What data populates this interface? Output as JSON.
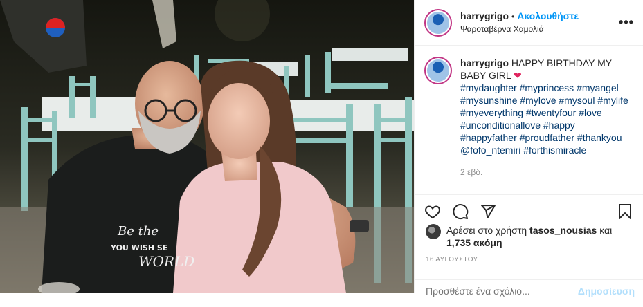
{
  "header": {
    "username": "harrygrigo",
    "separator": "•",
    "follow_label": "Ακολουθήστε",
    "location": "Ψαροταβέρνα Χαμολιά",
    "more_label": "•••"
  },
  "photo": {
    "shirt_text_1": "Be the",
    "shirt_text_2": "YOU WISH SE",
    "shirt_text_3": "WORLD"
  },
  "caption": {
    "username": "harrygrigo",
    "text": "HAPPY BIRTHDAY MY BABY GIRL",
    "emoji": "❤",
    "hashtags": "#mydaughter #myprincess #myangel #mysunshine #mylove #mysoul #mylife #myeverything #twentyfour #love #unconditionallove #happy #happyfather #proudfather #thankyou @fofo_ntemiri #forthismiracle",
    "time": "2 εβδ."
  },
  "likes": {
    "prefix": "Αρέσει στο χρήστη",
    "user": "tasos_nousias",
    "middle": "και",
    "count": "1,735 ακόμη"
  },
  "date": "16 ΑΥΓΟΥΣΤΟΥ",
  "comment": {
    "placeholder": "Προσθέστε ένα σχόλιο...",
    "post_label": "Δημοσίευση"
  },
  "icons": {
    "like": "heart-icon",
    "comment": "comment-icon",
    "share": "share-icon",
    "save": "bookmark-icon",
    "more": "more-options-icon"
  },
  "colors": {
    "follow": "#0095f6",
    "hashtag": "#00376b",
    "heart_emoji": "#e0245e",
    "post_disabled": "#b2dffc"
  }
}
